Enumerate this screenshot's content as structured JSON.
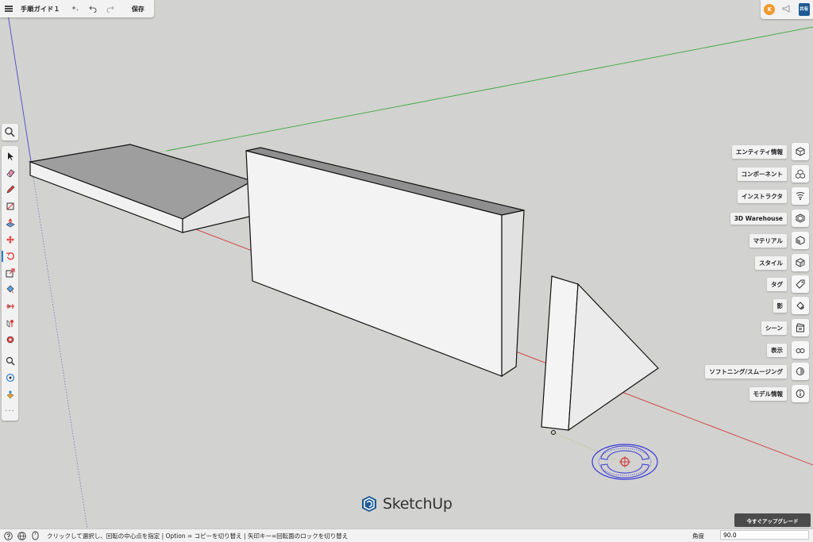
{
  "app": {
    "title": "手順ガイド１",
    "save_label": "保存",
    "logo_text": "SketchUp"
  },
  "topbar": {
    "icons": [
      "menu-icon",
      "magic-add-icon",
      "undo-icon",
      "redo-icon"
    ]
  },
  "topright": {
    "avatar_initial": "K",
    "share_label": "共有"
  },
  "left_toolbar": {
    "tools": [
      "select-icon",
      "eraser-icon",
      "pencil-icon",
      "shape-icon",
      "push-pull-icon",
      "move-icon",
      "rotate-icon",
      "scale-icon",
      "paint-icon",
      "offset-icon",
      "follow-me-icon",
      "tape-measure-icon",
      "zoom-icon",
      "orbit-icon",
      "walk-icon"
    ],
    "active_tool": "rotate-icon",
    "more_label": "···"
  },
  "right_panel": {
    "items": [
      {
        "label": "エンティティ情報",
        "icon": "entity-info-icon"
      },
      {
        "label": "コンポーネント",
        "icon": "components-icon"
      },
      {
        "label": "インストラクタ",
        "icon": "instructor-icon"
      },
      {
        "label": "3D Warehouse",
        "icon": "warehouse-icon"
      },
      {
        "label": "マテリアル",
        "icon": "materials-icon"
      },
      {
        "label": "スタイル",
        "icon": "styles-icon"
      },
      {
        "label": "タグ",
        "icon": "tags-icon"
      },
      {
        "label": "影",
        "icon": "shadows-icon"
      },
      {
        "label": "シーン",
        "icon": "scenes-icon"
      },
      {
        "label": "表示",
        "icon": "display-icon"
      },
      {
        "label": "ソフトニング/スムージング",
        "icon": "soften-icon"
      },
      {
        "label": "モデル情報",
        "icon": "model-info-icon"
      }
    ]
  },
  "upgrade_label": "今すぐアップグレード",
  "statusbar": {
    "text": "クリックして選択し、回転の中心点を指定 | Option = コピーを切り替え | 矢印キー=回転面のロックを切り替え",
    "measure_label": "角度",
    "measure_value": "90.0"
  },
  "colors": {
    "background": "#d2d2d0",
    "axis_red": "#d03a3a",
    "axis_green": "#3aaa3a",
    "axis_blue": "#4a4ac8",
    "protractor": "#3a3ad8",
    "accent": "#2a7fd4",
    "avatar": "#f29a2e",
    "share": "#1d5a93"
  }
}
